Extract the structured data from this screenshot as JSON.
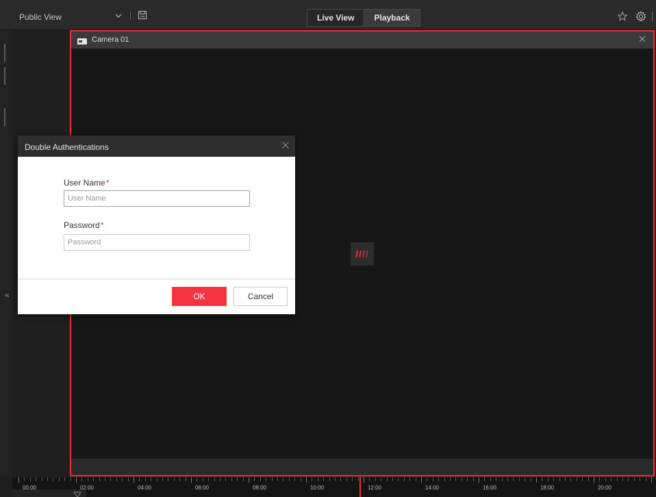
{
  "toolbar": {
    "view_name": "Public View",
    "dropdown_icon": "chevron-down-icon",
    "save_icon": "save-icon",
    "tabs": [
      {
        "label": "Live View",
        "active": false
      },
      {
        "label": "Playback",
        "active": true
      }
    ],
    "favorite_icon": "star-icon",
    "settings_icon": "gear-icon"
  },
  "camera": {
    "title": "Camera 01",
    "type_icon": "camera-icon",
    "close_icon": "close-icon",
    "loading_icon": "loading-icon",
    "selected_border_color": "#e8303a"
  },
  "timeline": {
    "labels": [
      "00:00",
      "02:00",
      "04:00",
      "06:00",
      "08:00",
      "10:00",
      "12:00",
      "14:00",
      "16:00",
      "18:00",
      "20:00"
    ],
    "cursor_color": "#e8303a"
  },
  "dialog": {
    "title": "Double Authentications",
    "username_label": "User Name",
    "username_placeholder": "User Name",
    "username_value": "",
    "password_label": "Password",
    "password_placeholder": "Password",
    "password_value": "",
    "required_mark": "*",
    "ok_label": "OK",
    "cancel_label": "Cancel",
    "accent_color": "#f5333f"
  }
}
